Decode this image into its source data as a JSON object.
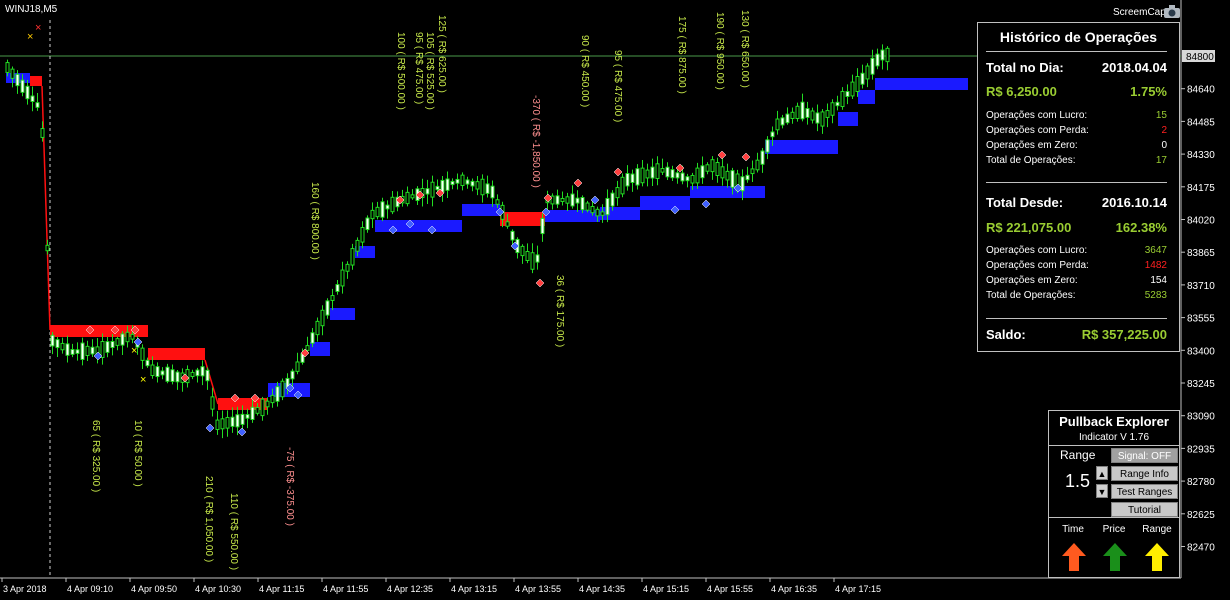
{
  "chart": {
    "symbol": "WINJ18,M5",
    "screencap_label": "ScreemCap",
    "price_ticks": [
      "84800",
      "84640",
      "84485",
      "84330",
      "84175",
      "84020",
      "83865",
      "83710",
      "83555",
      "83400",
      "83245",
      "83090",
      "82935",
      "82780",
      "82625",
      "82470"
    ],
    "current_price": "84800",
    "time_ticks": [
      "3 Apr 2018",
      "4 Apr 09:10",
      "4 Apr 09:50",
      "4 Apr 10:30",
      "4 Apr 11:15",
      "4 Apr 11:55",
      "4 Apr 12:35",
      "4 Apr 13:15",
      "4 Apr 13:55",
      "4 Apr 14:35",
      "4 Apr 15:15",
      "4 Apr 15:55",
      "4 Apr 16:35",
      "4 Apr 17:15"
    ],
    "trade_labels": [
      {
        "text": "65 ( R$ 325.00 )",
        "color": "#c7e84a"
      },
      {
        "text": "10 ( R$ 50.00 )",
        "color": "#c7e84a"
      },
      {
        "text": "210 ( R$ 1,050.00 )",
        "color": "#c7e84a"
      },
      {
        "text": "110 ( R$ 550.00 )",
        "color": "#c7e84a"
      },
      {
        "text": "-75 ( R$ -375.00 )",
        "color": "#ff9090"
      },
      {
        "text": "160 ( R$ 800.00 )",
        "color": "#c7e84a"
      },
      {
        "text": "100 ( R$ 500.00 )",
        "color": "#c7e84a"
      },
      {
        "text": "95 ( R$ 475.00 )",
        "color": "#c7e84a"
      },
      {
        "text": "105 ( R$ 525.00 )",
        "color": "#c7e84a"
      },
      {
        "text": "125 ( R$ 625.00 )",
        "color": "#c7e84a"
      },
      {
        "text": "-370 ( R$ -1,850.00 )",
        "color": "#ff9090"
      },
      {
        "text": "36 ( R$ 175.00 )",
        "color": "#c7e84a"
      },
      {
        "text": "90 ( R$ 450.00 )",
        "color": "#c7e84a"
      },
      {
        "text": "95 ( R$ 475.00 )",
        "color": "#c7e84a"
      },
      {
        "text": "175 ( R$ 875.00 )",
        "color": "#c7e84a"
      },
      {
        "text": "190 ( R$ 950.00 )",
        "color": "#c7e84a"
      },
      {
        "text": "130 ( R$ 650.00 )",
        "color": "#c7e84a"
      }
    ]
  },
  "history": {
    "title": "Histórico de Operações",
    "day_label": "Total no Dia:",
    "day_date": "2018.04.04",
    "day_amount": "R$ 6,250.00",
    "day_pct": "1.75%",
    "day_profit_label": "Operações com Lucro:",
    "day_profit": "15",
    "day_loss_label": "Operações com Perda:",
    "day_loss": "2",
    "day_zero_label": "Operações em Zero:",
    "day_zero": "0",
    "day_total_label": "Total de Operações:",
    "day_total": "17",
    "since_label": "Total Desde:",
    "since_date": "2016.10.14",
    "since_amount": "R$ 221,075.00",
    "since_pct": "162.38%",
    "since_profit_label": "Operações com Lucro:",
    "since_profit": "3647",
    "since_loss_label": "Operações com Perda:",
    "since_loss": "1482",
    "since_zero_label": "Operações em Zero:",
    "since_zero": "154",
    "since_total_label": "Total de Operações:",
    "since_total": "5283",
    "balance_label": "Saldo:",
    "balance": "R$ 357,225.00"
  },
  "pullback": {
    "title": "Pullback Explorer",
    "subtitle": "Indicator V 1.76",
    "range_label": "Range",
    "range_value": "1.5",
    "signal_button": "Signal: OFF",
    "range_info_button": "Range Info",
    "test_ranges_button": "Test Ranges",
    "tutorial_button": "Tutorial",
    "time_label": "Time",
    "price_label": "Price",
    "range_col_label": "Range",
    "colors": {
      "time": "#ff5a1f",
      "price": "#1a8f1a",
      "range": "#ffee00"
    }
  }
}
